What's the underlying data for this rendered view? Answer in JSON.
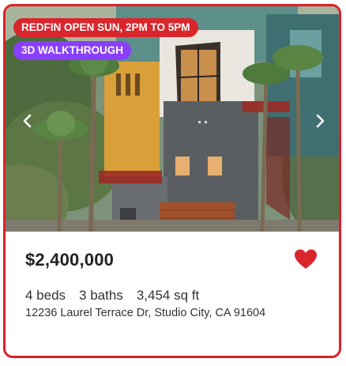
{
  "listing": {
    "badges": {
      "open_house": "REDFIN OPEN SUN, 2PM TO 5PM",
      "walkthrough": "3D WALKTHROUGH"
    },
    "photo": {
      "description_icon": "house-photo",
      "prev_icon": "chevron-left-icon",
      "next_icon": "chevron-right-icon"
    },
    "price": "$2,400,000",
    "beds": "4 beds",
    "baths": "3 baths",
    "sqft": "3,454 sq ft",
    "address": "12236 Laurel Terrace Dr, Studio City, CA 91604",
    "favorite_icon": "heart-icon"
  },
  "colors": {
    "accent_red": "#e01f26",
    "badge_open_bg": "#d9262c",
    "badge_3d_bg": "#8a3ffc",
    "heart": "#d9262c",
    "text_primary": "#222222"
  }
}
